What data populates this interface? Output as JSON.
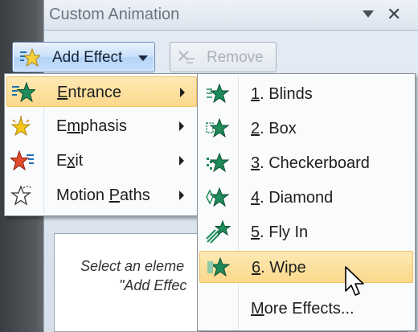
{
  "pane": {
    "title": "Custom Animation"
  },
  "toolbar": {
    "add_effect_label": "Add Effect",
    "remove_label": "Remove"
  },
  "hint": {
    "line1": "Select an eleme",
    "line2": "\"Add Effec"
  },
  "menu": {
    "items": [
      {
        "label_ul": "E",
        "label_rest": "ntrance",
        "icon": "entrance-star-icon"
      },
      {
        "label_pre": "E",
        "label_ul": "m",
        "label_rest": "phasis",
        "icon": "emphasis-star-icon"
      },
      {
        "label_pre": "E",
        "label_ul": "x",
        "label_rest": "it",
        "icon": "exit-star-icon"
      },
      {
        "label_pre": "Motion ",
        "label_ul": "P",
        "label_rest": "aths",
        "icon": "motion-path-star-icon"
      }
    ]
  },
  "submenu": {
    "items": [
      {
        "num": "1",
        "rest": ". Blinds"
      },
      {
        "num": "2",
        "rest": ". Box"
      },
      {
        "num": "3",
        "rest": ". Checkerboard"
      },
      {
        "num": "4",
        "rest": ". Diamond"
      },
      {
        "num": "5",
        "rest": ". Fly In"
      },
      {
        "num": "6",
        "rest": ". Wipe"
      }
    ],
    "more_ul": "M",
    "more_rest": "ore Effects..."
  },
  "colors": {
    "highlight": "#fcd88b",
    "entrance_green": "#1f8a5a",
    "exit_red": "#e04a2a",
    "emphasis_yellow": "#f5c518"
  }
}
